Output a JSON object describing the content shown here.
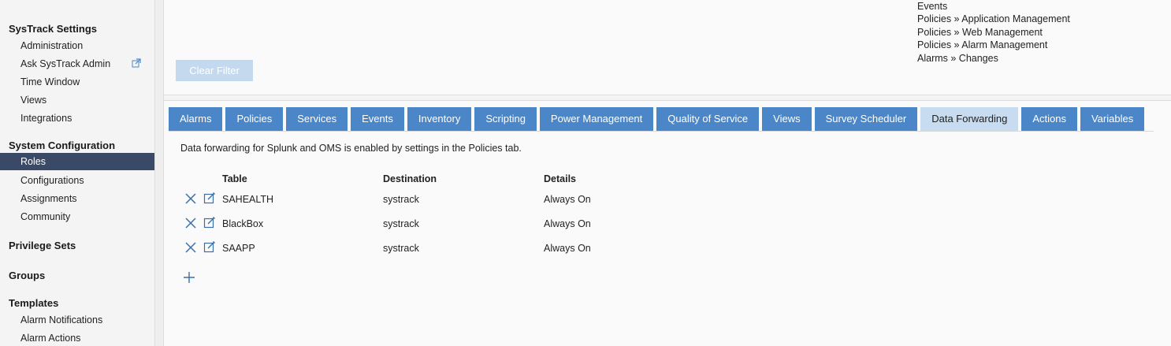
{
  "sidebar": {
    "sections": [
      {
        "title": "SysTrack Settings",
        "items": [
          "Administration",
          "Ask SysTrack Admin",
          "Time Window",
          "Views",
          "Integrations"
        ]
      },
      {
        "title": "System Configuration",
        "items": [
          "Roles",
          "Configurations",
          "Assignments",
          "Community"
        ]
      },
      {
        "title": "Privilege Sets",
        "items": []
      },
      {
        "title": "Groups",
        "items": []
      },
      {
        "title": "Templates",
        "items": [
          "Alarm Notifications",
          "Alarm Actions"
        ]
      }
    ],
    "active_item": "Roles"
  },
  "filter": {
    "entries": [
      "Events",
      "Policies » Application Management",
      "Policies » Web Management",
      "Policies » Alarm Management",
      "Alarms » Changes"
    ],
    "clear_label": "Clear Filter"
  },
  "tabs": [
    "Alarms",
    "Policies",
    "Services",
    "Events",
    "Inventory",
    "Scripting",
    "Power Management",
    "Quality of Service",
    "Views",
    "Survey Scheduler",
    "Data Forwarding",
    "Actions",
    "Variables"
  ],
  "active_tab": "Data Forwarding",
  "content": {
    "note": "Data forwarding for Splunk and OMS is enabled by settings in the Policies tab.",
    "columns": [
      "Table",
      "Destination",
      "Details"
    ],
    "rows": [
      {
        "table": "SAHEALTH",
        "destination": "systrack",
        "details": "Always On"
      },
      {
        "table": "BlackBox",
        "destination": "systrack",
        "details": "Always On"
      },
      {
        "table": "SAAPP",
        "destination": "systrack",
        "details": "Always On"
      }
    ]
  },
  "colors": {
    "tab": "#4a86c8",
    "tab_active": "#c7dcf0",
    "sidebar_active": "#3a4a66",
    "clear_button": "#c5d9ee",
    "icon": "#3a6fa8"
  }
}
